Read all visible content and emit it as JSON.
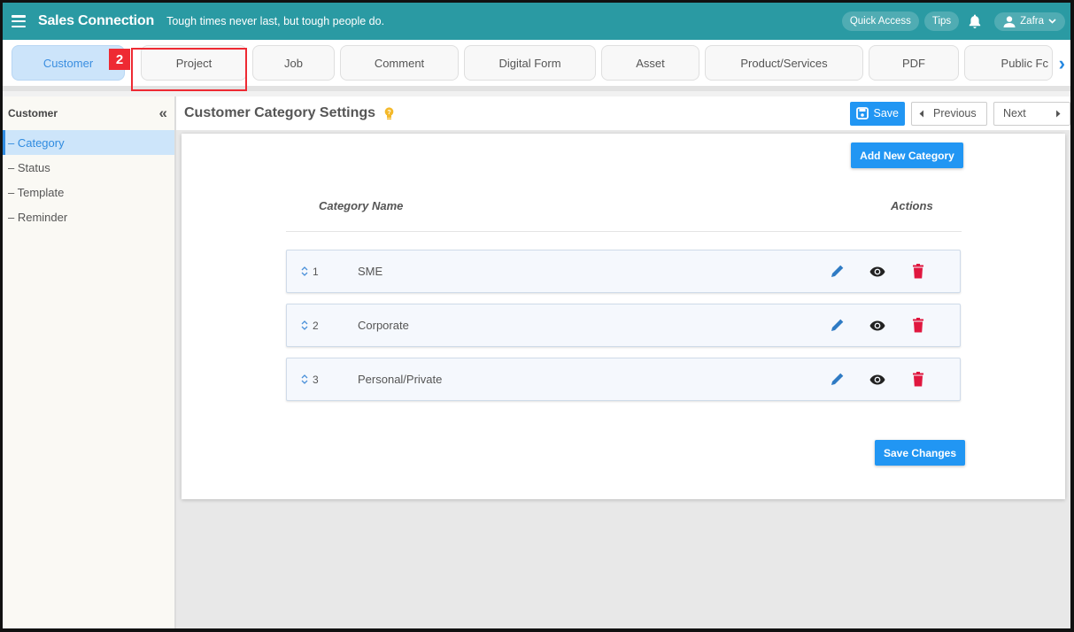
{
  "topbar": {
    "brand": "Sales Connection",
    "tagline": "Tough times never last, but tough people do.",
    "quick_access": "Quick Access",
    "tips": "Tips",
    "user_name": "Zafra",
    "accent_color": "#2a9aa3"
  },
  "tabs": [
    {
      "label": "Customer",
      "active": true
    },
    {
      "label": "Project",
      "active": false
    },
    {
      "label": "Job",
      "active": false
    },
    {
      "label": "Comment",
      "active": false
    },
    {
      "label": "Digital Form",
      "active": false
    },
    {
      "label": "Asset",
      "active": false
    },
    {
      "label": "Product/Services",
      "active": false
    },
    {
      "label": "PDF",
      "active": false
    },
    {
      "label": "Public Fc",
      "active": false
    }
  ],
  "callout": {
    "number": "2",
    "color": "#ee2a33"
  },
  "sidebar": {
    "title": "Customer",
    "items": [
      {
        "label": "– Category",
        "active": true
      },
      {
        "label": "– Status",
        "active": false
      },
      {
        "label": "– Template",
        "active": false
      },
      {
        "label": "– Reminder",
        "active": false
      }
    ]
  },
  "main": {
    "title": "Customer Category Settings",
    "save_label": "Save",
    "previous_label": "Previous",
    "next_label": "Next",
    "add_button": "Add New Category",
    "save_changes": "Save Changes",
    "columns": {
      "name": "Category Name",
      "actions": "Actions"
    },
    "rows": [
      {
        "order": "1",
        "name": "SME"
      },
      {
        "order": "2",
        "name": "Corporate"
      },
      {
        "order": "3",
        "name": "Personal/Private"
      }
    ],
    "colors": {
      "primary": "#2196f3",
      "edit": "#2f7bc4",
      "view": "#222222",
      "delete": "#e0173f"
    }
  }
}
